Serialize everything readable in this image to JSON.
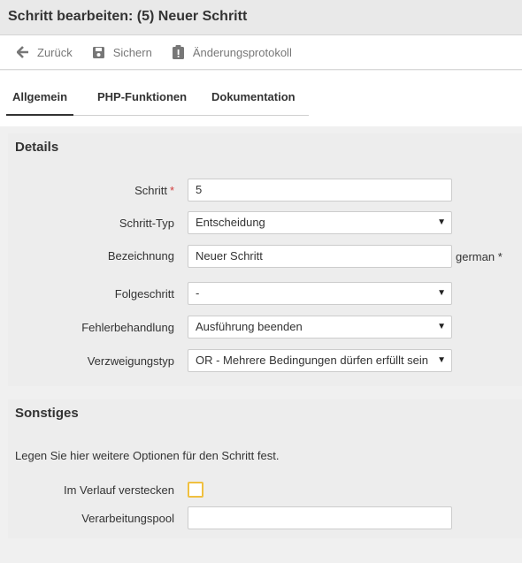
{
  "title": "Schritt bearbeiten: (5) Neuer Schritt",
  "toolbar": {
    "back": "Zurück",
    "save": "Sichern",
    "changelog": "Änderungsprotokoll"
  },
  "tabs": [
    "Allgemein",
    "PHP-Funktionen",
    "Dokumentation"
  ],
  "details": {
    "heading": "Details",
    "step_label": "Schritt",
    "required_mark": "*",
    "step_value": "5",
    "step_type_label": "Schritt-Typ",
    "step_type_value": "Entscheidung",
    "name_label": "Bezeichnung",
    "name_value": "Neuer Schritt",
    "name_suffix": "german *",
    "next_label": "Folgeschritt",
    "next_value": "-",
    "error_label": "Fehlerbehandlung",
    "error_value": "Ausführung beenden",
    "branch_label": "Verzweigungstyp",
    "branch_value": "OR - Mehrere Bedingungen dürfen erfüllt sein"
  },
  "other": {
    "heading": "Sonstiges",
    "description": "Legen Sie hier weitere Optionen für den Schritt fest.",
    "hide_label": "Im Verlauf verstecken",
    "pool_label": "Verarbeitungspool",
    "pool_value": ""
  },
  "colors": {
    "checkbox_border": "#f0c040",
    "required": "#d23c3c"
  }
}
